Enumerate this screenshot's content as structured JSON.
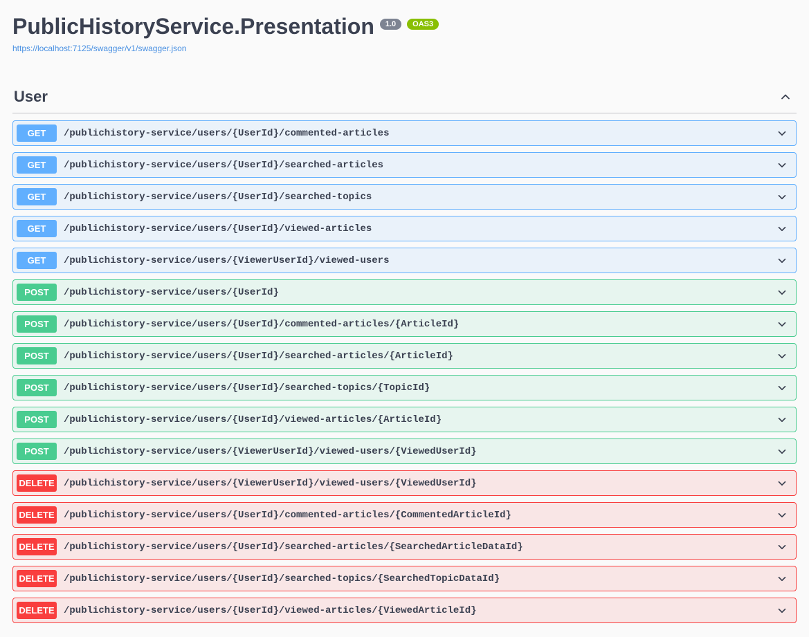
{
  "title": "PublicHistoryService.Presentation",
  "version": "1.0",
  "oas_label": "OAS3",
  "spec_url": "https://localhost:7125/swagger/v1/swagger.json",
  "section": {
    "name": "User"
  },
  "operations": [
    {
      "method": "GET",
      "path": "/publichistory-service/users/{UserId}/commented-articles"
    },
    {
      "method": "GET",
      "path": "/publichistory-service/users/{UserId}/searched-articles"
    },
    {
      "method": "GET",
      "path": "/publichistory-service/users/{UserId}/searched-topics"
    },
    {
      "method": "GET",
      "path": "/publichistory-service/users/{UserId}/viewed-articles"
    },
    {
      "method": "GET",
      "path": "/publichistory-service/users/{ViewerUserId}/viewed-users"
    },
    {
      "method": "POST",
      "path": "/publichistory-service/users/{UserId}"
    },
    {
      "method": "POST",
      "path": "/publichistory-service/users/{UserId}/commented-articles/{ArticleId}"
    },
    {
      "method": "POST",
      "path": "/publichistory-service/users/{UserId}/searched-articles/{ArticleId}"
    },
    {
      "method": "POST",
      "path": "/publichistory-service/users/{UserId}/searched-topics/{TopicId}"
    },
    {
      "method": "POST",
      "path": "/publichistory-service/users/{UserId}/viewed-articles/{ArticleId}"
    },
    {
      "method": "POST",
      "path": "/publichistory-service/users/{ViewerUserId}/viewed-users/{ViewedUserId}"
    },
    {
      "method": "DELETE",
      "path": "/publichistory-service/users/{ViewerUserId}/viewed-users/{ViewedUserId}"
    },
    {
      "method": "DELETE",
      "path": "/publichistory-service/users/{UserId}/commented-articles/{CommentedArticleId}"
    },
    {
      "method": "DELETE",
      "path": "/publichistory-service/users/{UserId}/searched-articles/{SearchedArticleDataId}"
    },
    {
      "method": "DELETE",
      "path": "/publichistory-service/users/{UserId}/searched-topics/{SearchedTopicDataId}"
    },
    {
      "method": "DELETE",
      "path": "/publichistory-service/users/{UserId}/viewed-articles/{ViewedArticleId}"
    }
  ]
}
